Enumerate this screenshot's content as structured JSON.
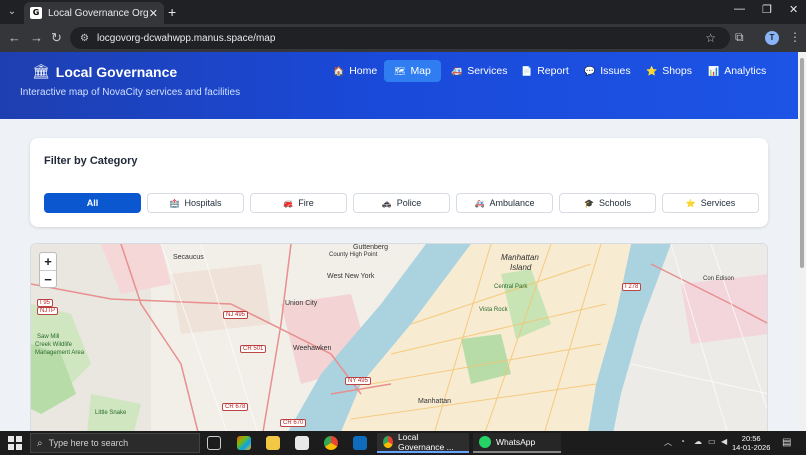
{
  "browser": {
    "tab_title": "Local Governance Organizer",
    "tab_favicon": "G",
    "url": "locgovorg-dcwahwpp.manus.space/map",
    "profile_initial": "T"
  },
  "header": {
    "brand": "Local Governance",
    "brand_icon": "🏛",
    "subtitle": "Interactive map of NovaCity services and facilities",
    "nav": [
      {
        "icon": "🏠",
        "label": "Home"
      },
      {
        "icon": "🗺",
        "label": "Map"
      },
      {
        "icon": "🚑",
        "label": "Services"
      },
      {
        "icon": "📄",
        "label": "Report"
      },
      {
        "icon": "💬",
        "label": "Issues"
      },
      {
        "icon": "⭐",
        "label": "Shops"
      },
      {
        "icon": "📊",
        "label": "Analytics"
      }
    ]
  },
  "filter": {
    "title": "Filter by Category",
    "chips": [
      {
        "icon": "",
        "label": "All"
      },
      {
        "icon": "🏥",
        "label": "Hospitals"
      },
      {
        "icon": "🚒",
        "label": "Fire"
      },
      {
        "icon": "🚓",
        "label": "Police"
      },
      {
        "icon": "🚑",
        "label": "Ambulance"
      },
      {
        "icon": "🎓",
        "label": "Schools"
      },
      {
        "icon": "⭐",
        "label": "Services"
      }
    ]
  },
  "map": {
    "zoom_in": "+",
    "zoom_out": "−",
    "labels": {
      "secaucus": "Secaucus",
      "guttenberg": "Guttenberg",
      "west_ny": "West New York",
      "union_city": "Union City",
      "weehawken": "Weehawken",
      "manhattan_island_1": "Manhattan",
      "manhattan_island_2": "Island",
      "central_park": "Central Park",
      "manhattan": "Manhattan",
      "county_high_point": "County High Point",
      "sawmill_1": "Saw Mill",
      "sawmill_2": "Creek Wildlife",
      "sawmill_3": "Management Area",
      "little_snake": "Little Snake",
      "con_edison": "Con Edison",
      "vista_rock": "Vista Rock"
    },
    "shields": {
      "i95": "I 95",
      "njtp": "NJTP",
      "nj495": "NJ 495",
      "cr501": "CR 501",
      "ny495": "NY 495",
      "cr678": "CR 678",
      "cr670": "CR 670",
      "i278": "I 278"
    }
  },
  "taskbar": {
    "search_placeholder": "Type here to search",
    "apps": [
      {
        "label": "Local Governance ..."
      },
      {
        "label": "WhatsApp"
      }
    ],
    "time": "20:56",
    "date": "14-01-2026"
  }
}
